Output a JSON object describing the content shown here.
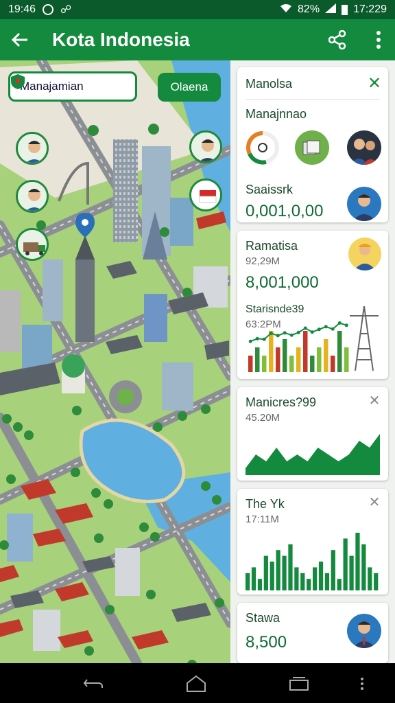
{
  "status": {
    "time": "19:46",
    "battery": "82%",
    "clock": "17:229"
  },
  "appbar": {
    "title": "Kota Indonesia"
  },
  "map": {
    "manage_label": "Manajamian",
    "open_label": "Olaena"
  },
  "panel": {
    "card1": {
      "title": "Manolsa",
      "section1": "Manajnnao",
      "section2": "Saaissrk",
      "value2": "0,001,0,00"
    },
    "card2": {
      "title": "Ramatisa",
      "sub": "92,29M",
      "value": "8,001,000",
      "title2": "Starisnde39",
      "sub2": "63:2PM"
    },
    "card3": {
      "title": "Manicres?99",
      "sub": "45.20M"
    },
    "card4": {
      "title": "The Yk",
      "sub": "17:11M"
    },
    "card5": {
      "title": "Stawa",
      "value": "8,500"
    }
  },
  "chart_data": [
    {
      "type": "bar",
      "values": [
        2,
        3,
        2,
        5,
        3,
        4,
        2,
        3,
        5,
        2,
        3,
        4,
        2,
        5,
        3
      ],
      "colors": [
        "#c0392b",
        "#2e8b3a",
        "#7fbf3a",
        "#e6b21e"
      ]
    },
    {
      "type": "area",
      "values": [
        1,
        3,
        2,
        4,
        2,
        3,
        2,
        4,
        3,
        2,
        3,
        5,
        4,
        6
      ]
    },
    {
      "type": "bar",
      "values": [
        3,
        4,
        2,
        6,
        5,
        7,
        6,
        8,
        4,
        3,
        2,
        4,
        5,
        3,
        7,
        2,
        9,
        6,
        10,
        8,
        4,
        3
      ]
    }
  ]
}
